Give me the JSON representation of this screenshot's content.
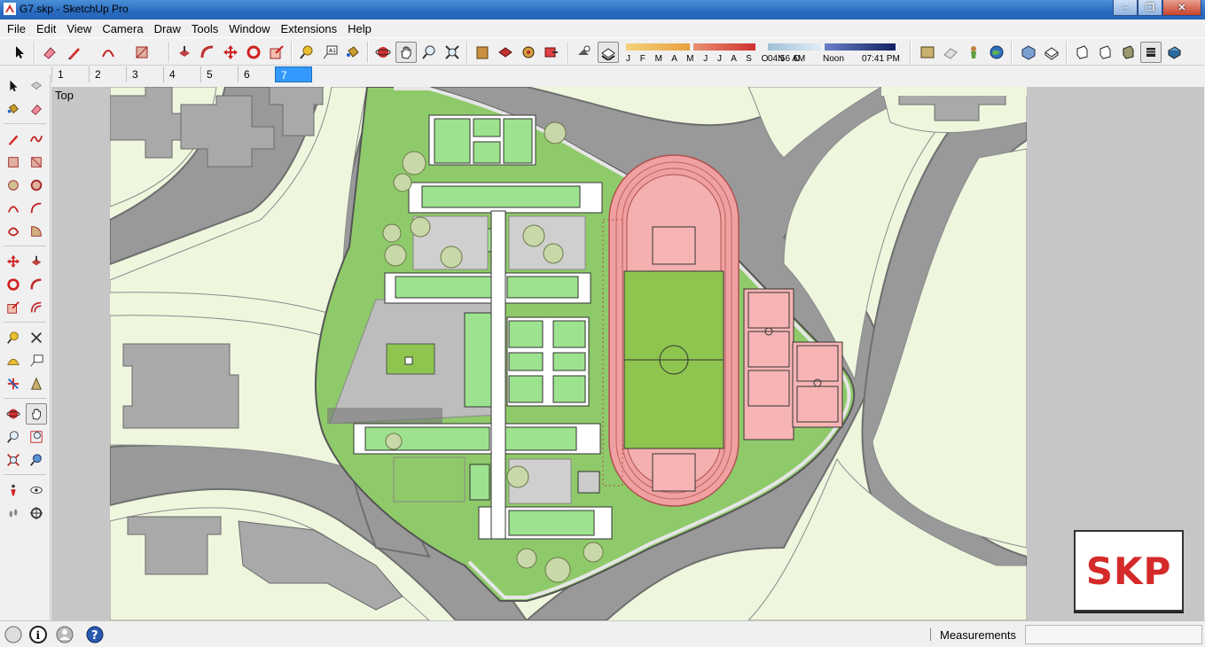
{
  "window": {
    "title": "G7.skp - SketchUp Pro",
    "minimize_icon": "minimize-icon",
    "maximize_icon": "maximize-icon",
    "close_icon": "close-icon"
  },
  "menu": [
    "File",
    "Edit",
    "View",
    "Camera",
    "Draw",
    "Tools",
    "Window",
    "Extensions",
    "Help"
  ],
  "toolbar": {
    "tools": [
      "select-icon",
      "eraser-icon",
      "pencil-icon",
      "arc-icon",
      "rectangle-icon",
      "push-pull-icon",
      "follow-me-icon",
      "move-icon",
      "rotate-icon",
      "scale-icon",
      "tape-measure-icon",
      "text-icon",
      "paint-bucket-icon",
      "orbit-icon",
      "pan-icon",
      "zoom-icon",
      "zoom-extents-icon",
      "warehouse-icon",
      "share-model-icon",
      "extension-warehouse-icon",
      "send-to-layout-icon",
      "shadows-icon",
      "fog-icon"
    ],
    "shadow_months": "J F M A M J J A S O N D",
    "time_start": "04:56 AM",
    "time_noon": "Noon",
    "time_end": "07:41 PM",
    "view_tools": [
      "iso-view-icon",
      "top-view-icon",
      "front-view-icon",
      "right-view-icon",
      "back-view-icon",
      "left-view-icon"
    ],
    "style_tools": [
      "xray-icon",
      "back-edges-icon",
      "wireframe-icon",
      "hidden-line-icon",
      "shaded-icon",
      "shaded-with-textures-icon",
      "monochrome-icon"
    ]
  },
  "scenes": [
    "1",
    "2",
    "3",
    "4",
    "5",
    "6",
    "7"
  ],
  "active_scene": "7",
  "view": {
    "label": "Top"
  },
  "watermark": "SKP",
  "status": {
    "measurements_label": "Measurements",
    "measurements_value": ""
  },
  "colors": {
    "ground": "#eef7de",
    "road": "#9a9a9a",
    "grass": "#7bbb52",
    "field": "#8ec54f",
    "track": "#f0a0a0",
    "court": "#f7b4b4",
    "building": "#9de28e",
    "active_scene": "#3399ff",
    "logo_red": "#d42a2a"
  }
}
